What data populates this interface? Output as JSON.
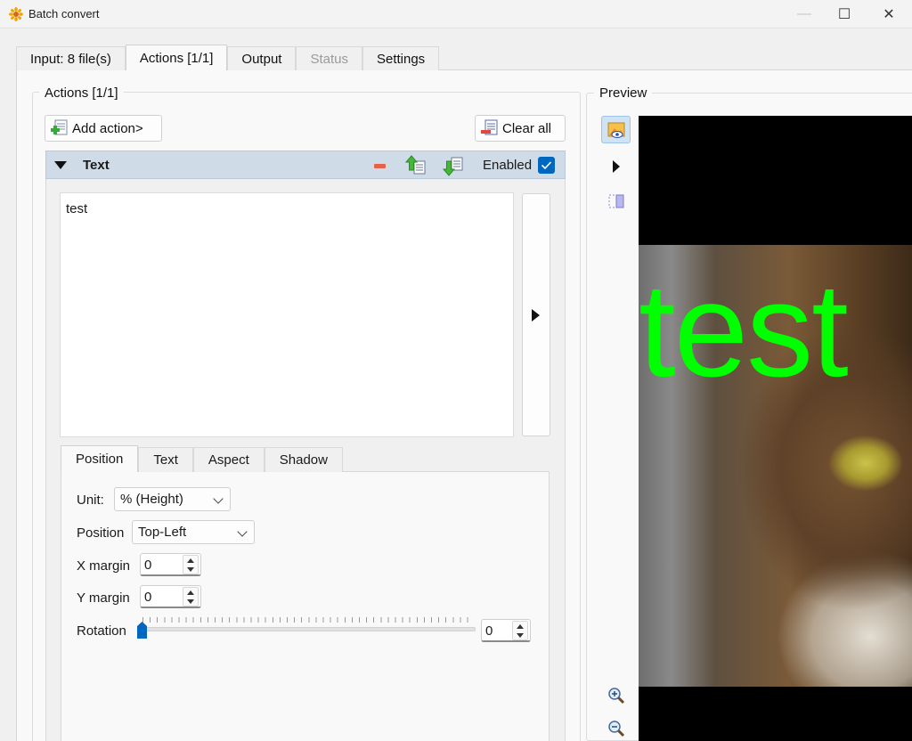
{
  "window": {
    "title": "Batch convert",
    "minimize_glyph": "—",
    "maximize_glyph": "☐",
    "close_glyph": "✕"
  },
  "tabs": [
    {
      "label": "Input: 8 file(s)"
    },
    {
      "label": "Actions [1/1]"
    },
    {
      "label": "Output"
    },
    {
      "label": "Status"
    },
    {
      "label": "Settings"
    }
  ],
  "actions": {
    "group_title": "Actions [1/1]",
    "add_action_label": "Add action>",
    "clear_all_label": "Clear all",
    "current": {
      "name": "Text",
      "enabled_label": "Enabled",
      "enabled": true,
      "text_value": "test"
    }
  },
  "subtabs": [
    {
      "label": "Position"
    },
    {
      "label": "Text"
    },
    {
      "label": "Aspect"
    },
    {
      "label": "Shadow"
    }
  ],
  "position_form": {
    "unit_label": "Unit:",
    "unit_value": "% (Height)",
    "position_label": "Position",
    "position_value": "Top-Left",
    "x_margin_label": "X margin",
    "x_margin_value": "0",
    "y_margin_label": "Y margin",
    "y_margin_value": "0",
    "rotation_label": "Rotation",
    "rotation_value": "0"
  },
  "preview": {
    "title": "Preview",
    "overlay_text": "test",
    "overlay_color": "#00ff00"
  },
  "colors": {
    "accent": "#0067c0",
    "header_bg": "#cfdbe7"
  }
}
